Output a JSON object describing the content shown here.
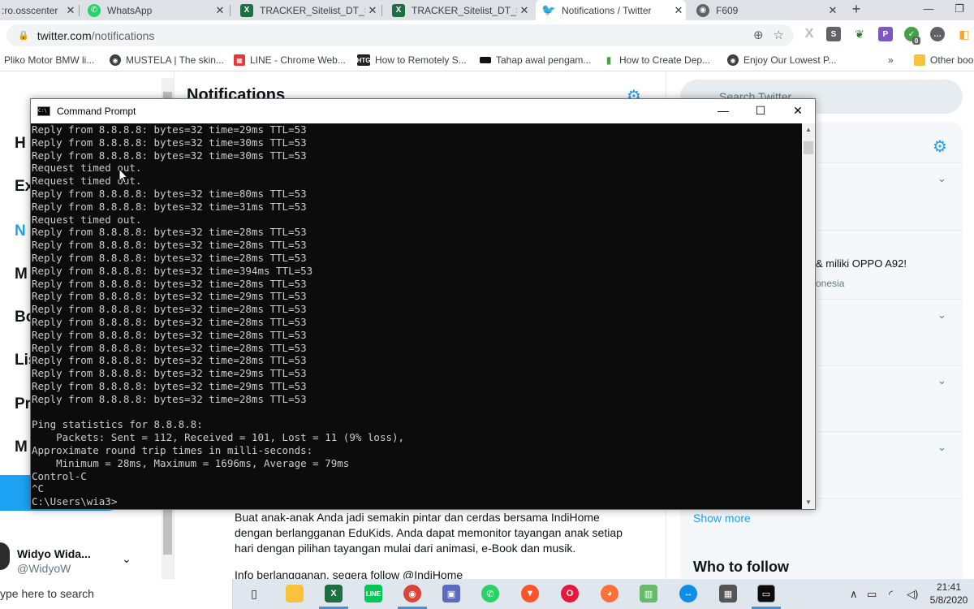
{
  "browser": {
    "tabs": [
      {
        "label": ":ro.osscenter",
        "icon": "page-icon",
        "active": false
      },
      {
        "label": "WhatsApp",
        "icon": "whatsapp-icon",
        "active": false
      },
      {
        "label": "TRACKER_Sitelist_DT_SS",
        "icon": "excel-icon",
        "active": false
      },
      {
        "label": "TRACKER_Sitelist_DT_SS",
        "icon": "excel-icon",
        "active": false
      },
      {
        "label": "Notifications / Twitter",
        "icon": "twitter-icon",
        "active": true
      },
      {
        "label": "F609",
        "icon": "globe-icon",
        "active": false
      }
    ],
    "new_tab_label": "+",
    "close_glyph": "✕",
    "address": {
      "host": "twitter.com",
      "path": "/notifications"
    },
    "bookmarks": [
      {
        "label": "Pliko Motor BMW li..."
      },
      {
        "label": "MUSTELA | The skin..."
      },
      {
        "label": "LINE - Chrome Web..."
      },
      {
        "label": "How to Remotely S..."
      },
      {
        "label": "Tahap awal pengam..."
      },
      {
        "label": "How to Create Dep..."
      },
      {
        "label": "Enjoy Our Lowest P..."
      }
    ],
    "bookmarks_overflow": "»",
    "other_bookmarks": "Other boo",
    "extension_badge": "0"
  },
  "twitter": {
    "page_title": "Notifications",
    "search_placeholder": "Search Twitter",
    "nav": [
      {
        "label": "Home",
        "visible": "H",
        "active": false
      },
      {
        "label": "Explore",
        "visible": "Ex",
        "active": false
      },
      {
        "label": "Notifications",
        "visible": "N",
        "active": true
      },
      {
        "label": "Messages",
        "visible": "M",
        "active": false
      },
      {
        "label": "Bookmarks",
        "visible": "Bo",
        "active": false
      },
      {
        "label": "Lists",
        "visible": "Lis",
        "active": false
      },
      {
        "label": "Profile",
        "visible": "Pr",
        "active": false
      },
      {
        "label": "More",
        "visible": "M",
        "active": false
      }
    ],
    "trend_line1": "& miliki OPPO A92!",
    "trend_line2": "onesia",
    "show_more": "Show more",
    "who_to_follow": "Who to follow",
    "tweet_text": "Buat anak-anak Anda jadi semakin pintar dan cerdas bersama IndiHome dengan berlangganan EduKids. Anda dapat memonitor tayangan anak setiap hari dengan pilihan tayangan mulai dari animasi, e-Book dan musik.",
    "tweet_text_cut": "Info berlangganan, segera follow @IndiHome",
    "account": {
      "name": "Widyo Wida...",
      "handle": "@WidyoW"
    },
    "accent_color": "#1da1f2"
  },
  "cmd": {
    "title": "Command Prompt",
    "lines": [
      "Reply from 8.8.8.8: bytes=32 time=29ms TTL=53",
      "Reply from 8.8.8.8: bytes=32 time=30ms TTL=53",
      "Reply from 8.8.8.8: bytes=32 time=30ms TTL=53",
      "Request timed out.",
      "Request timed out.",
      "Reply from 8.8.8.8: bytes=32 time=80ms TTL=53",
      "Reply from 8.8.8.8: bytes=32 time=31ms TTL=53",
      "Request timed out.",
      "Reply from 8.8.8.8: bytes=32 time=28ms TTL=53",
      "Reply from 8.8.8.8: bytes=32 time=28ms TTL=53",
      "Reply from 8.8.8.8: bytes=32 time=28ms TTL=53",
      "Reply from 8.8.8.8: bytes=32 time=394ms TTL=53",
      "Reply from 8.8.8.8: bytes=32 time=28ms TTL=53",
      "Reply from 8.8.8.8: bytes=32 time=29ms TTL=53",
      "Reply from 8.8.8.8: bytes=32 time=28ms TTL=53",
      "Reply from 8.8.8.8: bytes=32 time=28ms TTL=53",
      "Reply from 8.8.8.8: bytes=32 time=28ms TTL=53",
      "Reply from 8.8.8.8: bytes=32 time=28ms TTL=53",
      "Reply from 8.8.8.8: bytes=32 time=28ms TTL=53",
      "Reply from 8.8.8.8: bytes=32 time=29ms TTL=53",
      "Reply from 8.8.8.8: bytes=32 time=29ms TTL=53",
      "Reply from 8.8.8.8: bytes=32 time=28ms TTL=53",
      "",
      "Ping statistics for 8.8.8.8:",
      "    Packets: Sent = 112, Received = 101, Lost = 11 (9% loss),",
      "Approximate round trip times in milli-seconds:",
      "    Minimum = 28ms, Maximum = 1696ms, Average = 79ms",
      "Control-C",
      "^C",
      "C:\\Users\\wia3>"
    ],
    "minimize": "—",
    "maximize": "☐",
    "close": "✕"
  },
  "taskbar": {
    "search_placeholder": "ype here to search",
    "apps": [
      "task-view-icon",
      "file-explorer-icon",
      "excel-icon",
      "line-icon",
      "chrome-icon",
      "network-icon",
      "whatsapp-icon",
      "brave-icon",
      "opera-icon",
      "firefox-icon",
      "spreadsheet-icon",
      "teamviewer-icon",
      "calculator-icon",
      "cmd-icon"
    ],
    "time": "21:41",
    "date": "5/8/2020"
  }
}
